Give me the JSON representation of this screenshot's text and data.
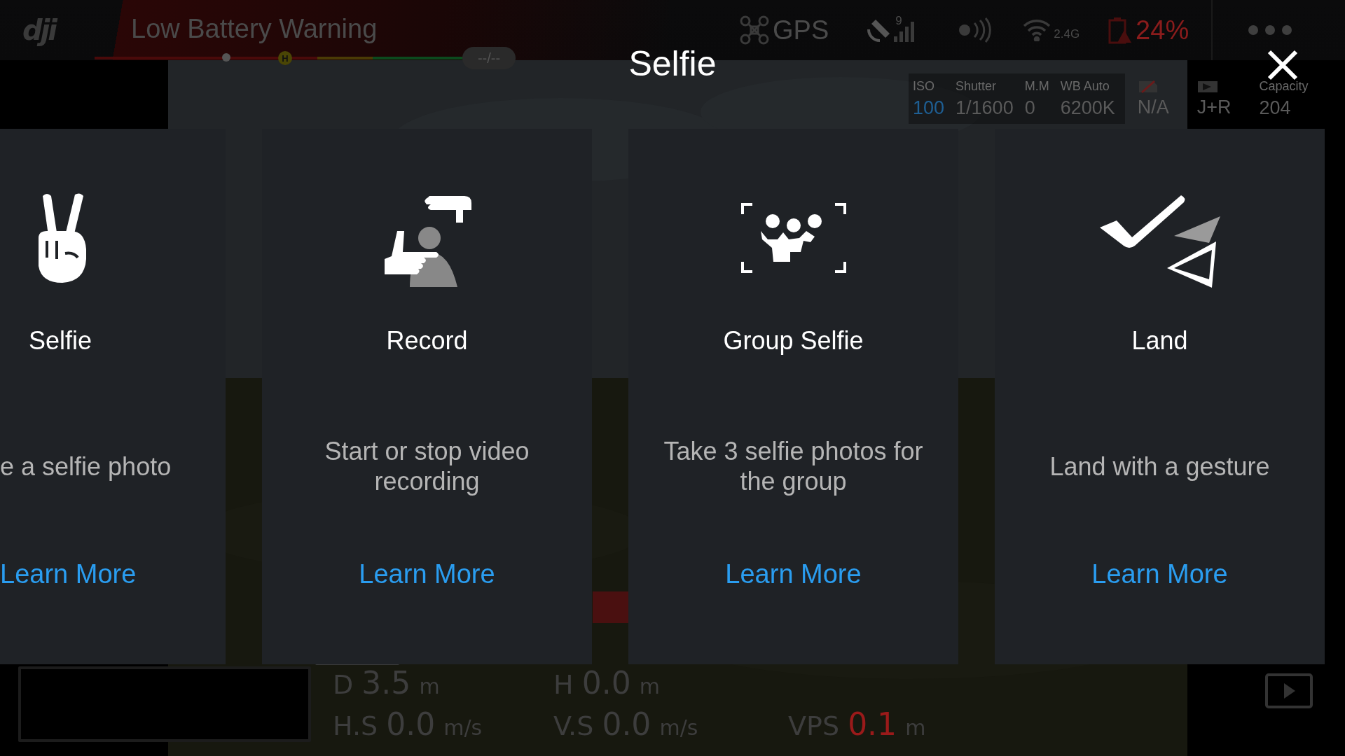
{
  "status_bar": {
    "logo": "dji",
    "warning": "Low Battery Warning",
    "home_marker": "H",
    "distance": "--/--",
    "gps": "GPS",
    "satellites": "9",
    "band": "2.4G",
    "battery": "24%"
  },
  "camera_settings": [
    {
      "label": "ISO",
      "value": "100",
      "highlighted": true
    },
    {
      "label": "Shutter",
      "value": "1/1600",
      "highlighted": false
    },
    {
      "label": "M.M",
      "value": "0",
      "highlighted": false
    },
    {
      "label": "WB  Auto",
      "value": "6200K",
      "highlighted": false
    }
  ],
  "storage": [
    {
      "value": "N/A"
    },
    {
      "value": "J+R"
    },
    {
      "label": "Capacity",
      "value": "204"
    }
  ],
  "telemetry": [
    {
      "label": "D",
      "value": "3.5",
      "unit": "m",
      "alert": false
    },
    {
      "label": "H",
      "value": "0.0",
      "unit": "m",
      "alert": false
    },
    {
      "label": "H.S",
      "value": "0.0",
      "unit": "m/s",
      "alert": false
    },
    {
      "label": "V.S",
      "value": "0.0",
      "unit": "m/s",
      "alert": false
    },
    {
      "label": "VPS",
      "value": "0.1",
      "unit": "m",
      "alert": true
    }
  ],
  "dialog": {
    "title": "Selfie",
    "cards": [
      {
        "kind": "partial",
        "title": "Selfie",
        "description": "e a selfie photo",
        "link": "Learn More"
      },
      {
        "kind": "full",
        "title": "Record",
        "description": "Start or stop video recording",
        "link": "Learn More"
      },
      {
        "kind": "full",
        "title": "Group Selfie",
        "description": "Take 3 selfie photos for the group",
        "link": "Learn More"
      },
      {
        "kind": "full",
        "title": "Land",
        "description": "Land with a gesture",
        "link": "Learn More"
      }
    ]
  }
}
